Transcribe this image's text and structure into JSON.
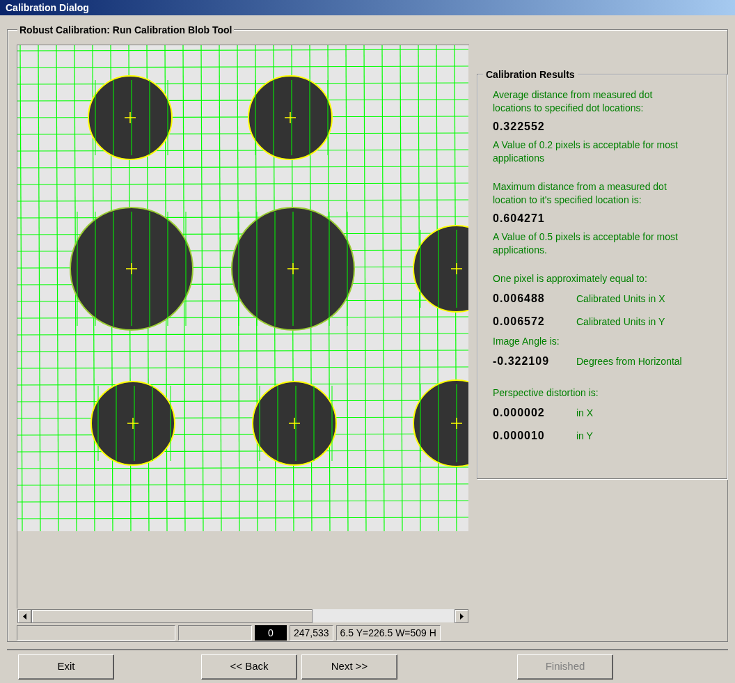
{
  "window": {
    "title": "Calibration Dialog"
  },
  "step": {
    "title": "Robust Calibration: Run Calibration Blob Tool"
  },
  "results": {
    "title": "Calibration Results",
    "sections": [
      {
        "lines": [
          {
            "kind": "caption",
            "text": "Average distance from measured dot locations to specified dot locations:"
          },
          {
            "kind": "value",
            "value": "0.322552"
          },
          {
            "kind": "caption",
            "text": "A Value of 0.2 pixels is acceptable for most applications"
          }
        ]
      },
      {
        "lines": [
          {
            "kind": "caption",
            "text": "Maximum distance from a measured dot location to it's specified location is:"
          },
          {
            "kind": "value",
            "value": "0.604271"
          },
          {
            "kind": "caption",
            "text": "A Value of 0.5 pixels is acceptable for most applications."
          }
        ]
      },
      {
        "lines": [
          {
            "kind": "caption",
            "text": "One pixel is approximately equal to:"
          },
          {
            "kind": "value_unit",
            "value": "0.006488",
            "unit": "Calibrated Units in X"
          },
          {
            "kind": "value_unit",
            "value": "0.006572",
            "unit": "Calibrated Units in Y"
          },
          {
            "kind": "caption",
            "text": "Image Angle is:"
          },
          {
            "kind": "value_unit",
            "value": "-0.322109",
            "unit": "Degrees from Horizontal"
          }
        ]
      },
      {
        "lines": [
          {
            "kind": "caption",
            "text": "Perspective distortion is:"
          },
          {
            "kind": "value_unit",
            "value": "0.000002",
            "unit": "in X"
          },
          {
            "kind": "value_unit",
            "value": "0.000010",
            "unit": "in Y"
          }
        ]
      }
    ]
  },
  "status_bar": {
    "panes": [
      {
        "kind": "blank"
      },
      {
        "kind": "blank"
      },
      {
        "kind": "counter",
        "text": "0"
      },
      {
        "kind": "text",
        "text": "247,533"
      },
      {
        "kind": "text",
        "text": "6.5 Y=226.5 W=509 H"
      }
    ]
  },
  "buttons": [
    {
      "label": "Exit",
      "disabled": false
    },
    {
      "label": "<< Back",
      "disabled": false
    },
    {
      "label": "Next >>",
      "disabled": false
    },
    {
      "label": "Finished",
      "disabled": true
    }
  ]
}
